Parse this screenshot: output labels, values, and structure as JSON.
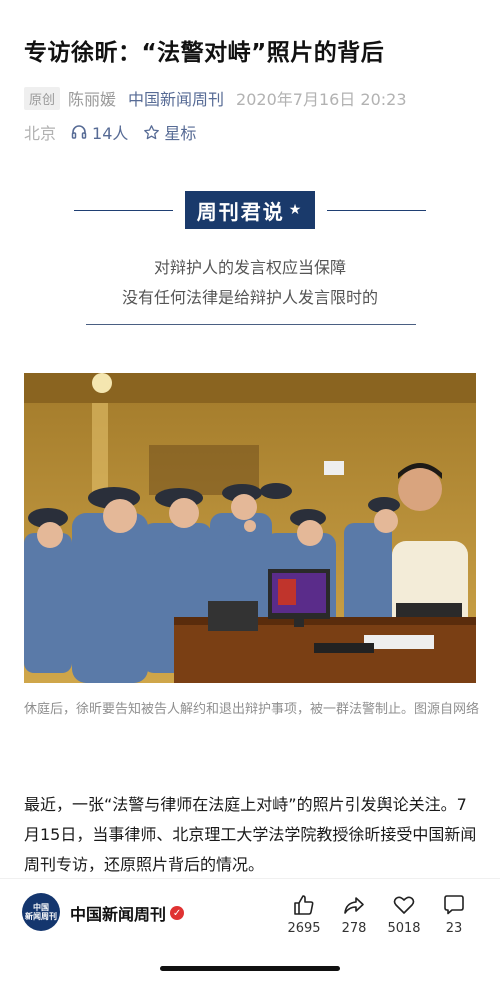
{
  "article": {
    "title": "专访徐昕：“法警对峙”照片的背后",
    "tag": "原创",
    "author": "陈丽媛",
    "source": "中国新闻周刊",
    "date": "2020年7月16日 20:23",
    "location": "北京",
    "listeners": "14人",
    "star_label": "星标"
  },
  "banner": {
    "label": "周刊君说",
    "lead_line1": "对辩护人的发言权应当保障",
    "lead_line2": "没有任何法律是给辩护人发言限时的"
  },
  "photo": {
    "caption": "休庭后，徐昕要告知被告人解约和退出辩护事项，被一群法警制止。图源自网络"
  },
  "body": {
    "paragraph": "最近，一张“法警与律师在法庭上对峙”的照片引发舆论关注。7月15日，当事律师、北京理工大学法学院教授徐昕接受中国新闻周刊专访，还原照片背后的情况。"
  },
  "bottom_bar": {
    "logo_text_line1": "中国",
    "logo_text_line2": "新闻周刊",
    "brand": "中国新闻周刊",
    "like_count": "2695",
    "share_count": "278",
    "favorite_count": "5018",
    "comment_count": "23"
  },
  "icons": {
    "listen": "headphones-icon",
    "star": "star-outline-icon",
    "like": "thumbs-up-icon",
    "share": "share-arrow-icon",
    "favorite": "heart-icon",
    "comment": "speech-bubble-icon"
  },
  "colors": {
    "link_blue": "#576b95",
    "banner_navy": "#1a3a6b",
    "verified_red": "#e03232"
  }
}
